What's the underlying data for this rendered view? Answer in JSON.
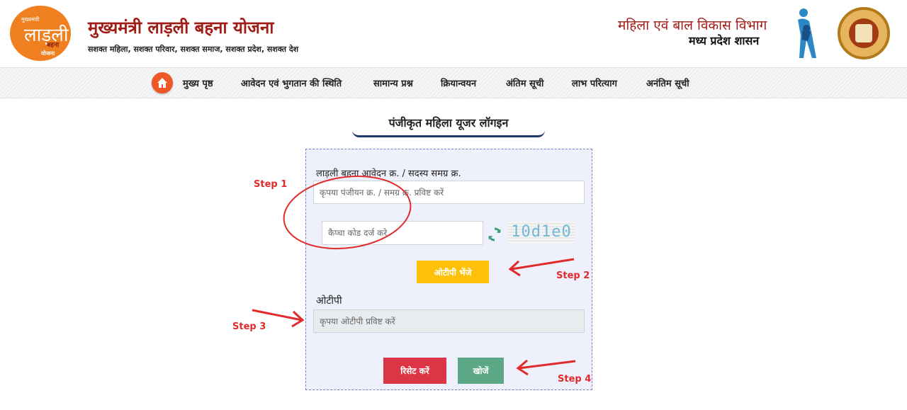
{
  "header": {
    "logo": {
      "line1": "मुख्यमंत्री",
      "line2": "लाड़ली",
      "line3": "बहना",
      "line4": "योजना"
    },
    "title": "मुख्यमंत्री लाड़ली बहना योजना",
    "tagline": "सशक्त महिला, सशक्त परिवार, सशक्त समाज, सशक्त प्रदेश, सशक्त देश",
    "department": "महिला एवं बाल विकास विभाग",
    "government": "मध्य प्रदेश शासन"
  },
  "nav": {
    "home_icon": "home-icon",
    "items": [
      "मुख्य पृष्ठ",
      "आवेदन एवं भुगतान की स्थिति",
      "सामान्य प्रश्न",
      "क्रियान्वयन",
      "अंतिम सूची",
      "लाभ परित्याग",
      "अनंतिम सूची"
    ]
  },
  "page": {
    "heading": "पंजीकृत महिला यूजर लॉगइन"
  },
  "form": {
    "registration_label": "लाड़ली बहना आवेदन क्र. / सदस्य समग्र क्र.",
    "registration_placeholder": "कृपया पंजीयन क्र. / समग्र क्र. प्रविष्ट करें",
    "captcha_placeholder": "कैप्चा कोड दर्ज करे",
    "captcha_code": "10d1e0",
    "send_otp_label": "ओटीपी भेंजे",
    "otp_label": "ओटीपी",
    "otp_placeholder": "कृपया ओटीपी प्रविष्ट करें",
    "reset_label": "रिसेट करें",
    "search_label": "खोजें"
  },
  "annotations": {
    "step1": "Step 1",
    "step2": "Step 2",
    "step3": "Step 3",
    "step4": "Step 4",
    "color": "#e12a2a"
  },
  "colors": {
    "brand_red": "#a01c16",
    "logo_orange": "#f07f1f",
    "home_orange": "#ee5726",
    "otp_yellow": "#ffc107",
    "reset_red": "#dc3545",
    "search_green": "#5ca886"
  }
}
